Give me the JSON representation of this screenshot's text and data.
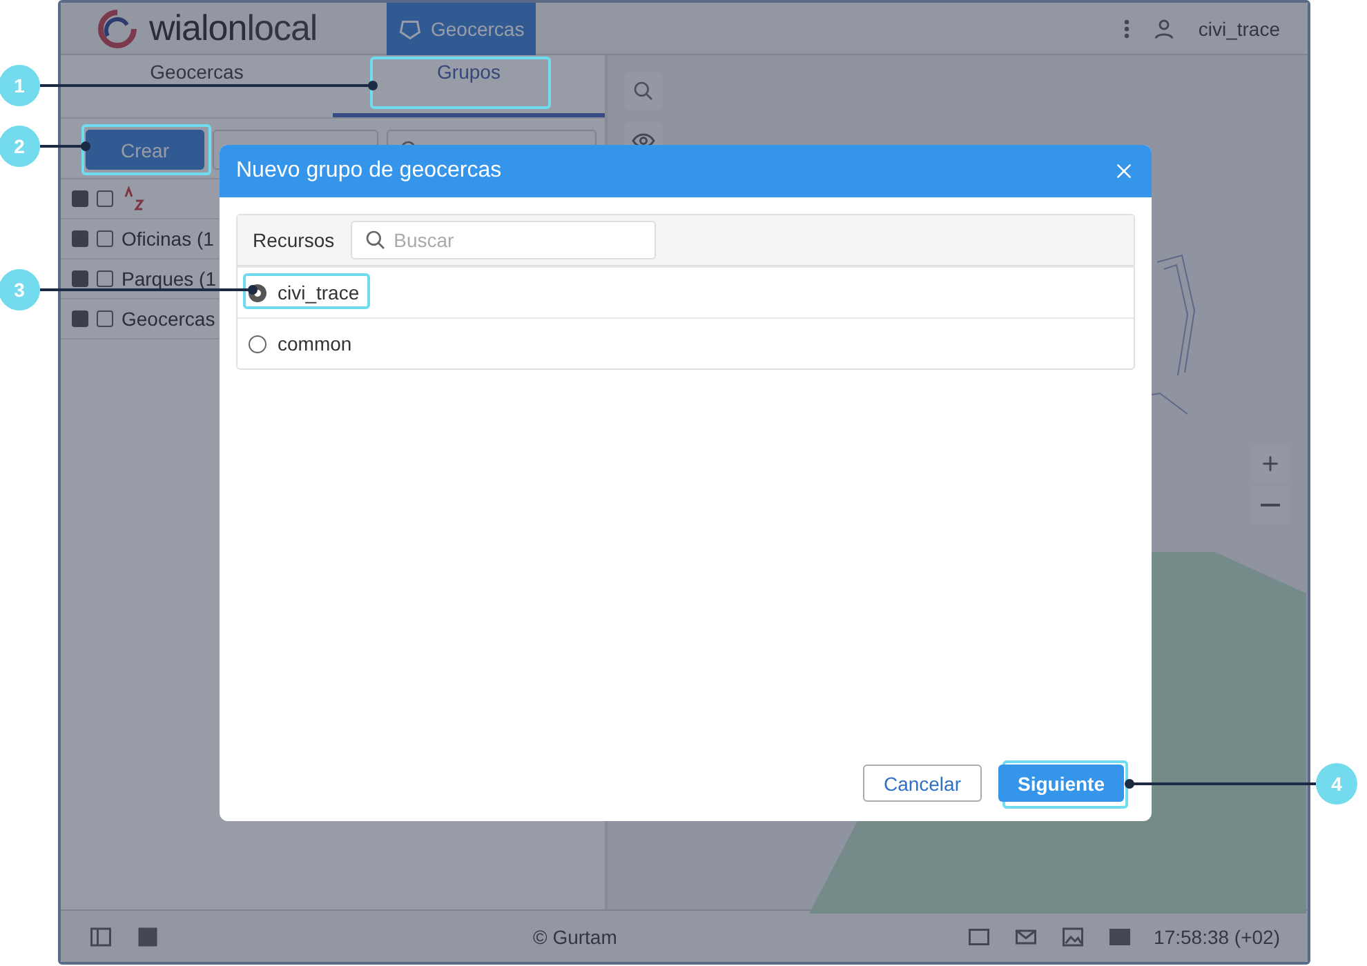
{
  "header": {
    "logo": {
      "main": "wialon",
      "suffix": "local"
    },
    "module": "Geocercas",
    "user": "civi_trace"
  },
  "sidebar": {
    "tabs": [
      {
        "label": "Geocercas",
        "selected": false
      },
      {
        "label": "Grupos",
        "selected": true
      }
    ],
    "create_button": "Crear",
    "select_all": {
      "checked": false
    },
    "groups": [
      {
        "label": "Oficinas (1",
        "checked": false
      },
      {
        "label": "Parques (1",
        "checked": false
      },
      {
        "label": "Geocercas",
        "checked": false
      }
    ]
  },
  "dialog": {
    "title": "Nuevo grupo de geocercas",
    "column": "Recursos",
    "placeholder": "Buscar",
    "resources": [
      {
        "name": "civi_trace",
        "selected": true
      },
      {
        "name": "common",
        "selected": false
      }
    ],
    "buttons": [
      {
        "label": "Cancelar",
        "kind": "secondary"
      },
      {
        "label": "Siguiente",
        "kind": "primary"
      }
    ]
  },
  "footer": {
    "copyright": "© Gurtam",
    "time": "17:58:38 (+02)"
  },
  "callouts": [
    "1",
    "2",
    "3",
    "4"
  ]
}
